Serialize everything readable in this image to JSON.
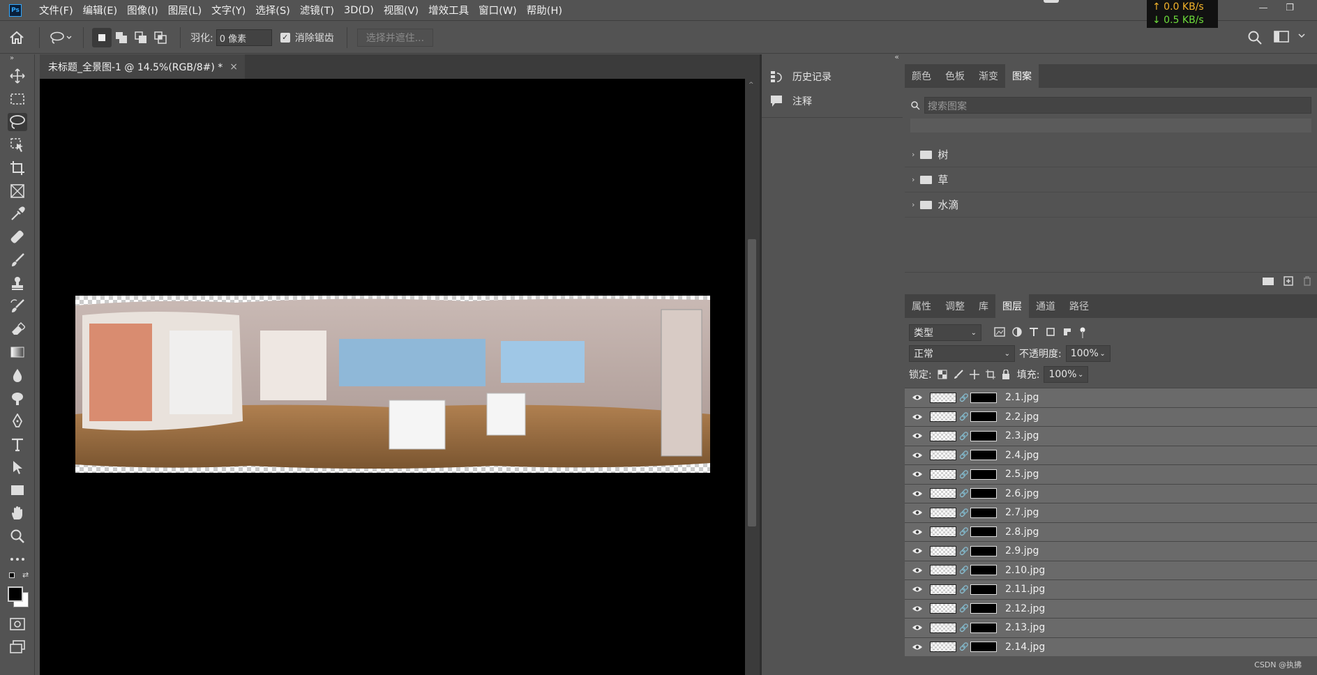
{
  "menu": [
    "文件(F)",
    "编辑(E)",
    "图像(I)",
    "图层(L)",
    "文字(Y)",
    "选择(S)",
    "滤镜(T)",
    "3D(D)",
    "视图(V)",
    "增效工具",
    "窗口(W)",
    "帮助(H)"
  ],
  "app_logo": "Ps",
  "netspeed": {
    "up": "↑ 0.0 KB/s",
    "down": "↓ 0.5 KB/s"
  },
  "options": {
    "feather_label": "羽化:",
    "feather_value": "0 像素",
    "antialias_label": "消除锯齿",
    "select_mask_label": "选择并遮住..."
  },
  "document": {
    "tab_title": "未标题_全景图-1 @ 14.5%(RGB/8#) *",
    "close": "×"
  },
  "mid_panel": {
    "history": "历史记录",
    "notes": "注释"
  },
  "top_panel": {
    "tabs": [
      "颜色",
      "色板",
      "渐变",
      "图案"
    ],
    "active_tab": "图案",
    "search_placeholder": "搜索图案",
    "groups": [
      "树",
      "草",
      "水滴"
    ]
  },
  "layers_panel": {
    "tabs": [
      "属性",
      "调整",
      "库",
      "图层",
      "通道",
      "路径"
    ],
    "active_tab": "图层",
    "filter": "类型",
    "blend_mode": "正常",
    "opacity_label": "不透明度:",
    "opacity_value": "100%",
    "lock_label": "锁定:",
    "fill_label": "填充:",
    "fill_value": "100%",
    "layers": [
      "2.1.jpg",
      "2.2.jpg",
      "2.3.jpg",
      "2.4.jpg",
      "2.5.jpg",
      "2.6.jpg",
      "2.7.jpg",
      "2.8.jpg",
      "2.9.jpg",
      "2.10.jpg",
      "2.11.jpg",
      "2.12.jpg",
      "2.13.jpg",
      "2.14.jpg"
    ]
  },
  "watermark": "CSDN @执拂"
}
